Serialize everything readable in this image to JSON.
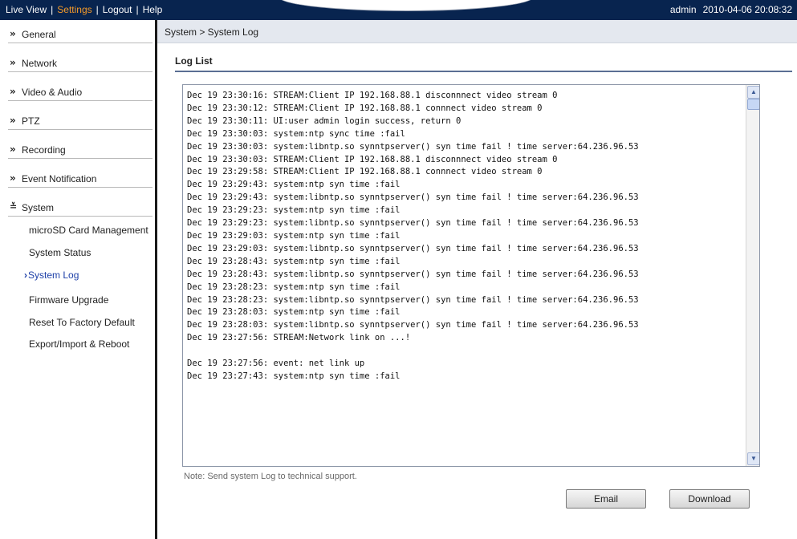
{
  "topbar": {
    "nav": [
      "Live View",
      "Settings",
      "Logout",
      "Help"
    ],
    "active": "Settings",
    "separator": "|",
    "user": "admin",
    "datetime": "2010-04-06 20:08:32"
  },
  "sidebar": {
    "chevron_glyph": "»",
    "open_glyph": "≚",
    "sections": [
      "General",
      "Network",
      "Video & Audio",
      "PTZ",
      "Recording",
      "Event Notification",
      "System"
    ],
    "system_items": [
      "microSD Card Management",
      "System Status",
      "System Log",
      "Firmware Upgrade",
      "Reset To Factory Default",
      "Export/Import & Reboot"
    ],
    "current_item": "System Log",
    "current_marker": "›"
  },
  "main": {
    "breadcrumb": "System > System Log",
    "section_title": "Log List",
    "log_text": "Dec 19 23:30:16: STREAM:Client IP 192.168.88.1 disconnnect video stream 0\nDec 19 23:30:12: STREAM:Client IP 192.168.88.1 connnect video stream 0\nDec 19 23:30:11: UI:user admin login success, return 0\nDec 19 23:30:03: system:ntp sync time :fail\nDec 19 23:30:03: system:libntp.so synntpserver() syn time fail ! time server:64.236.96.53\nDec 19 23:30:03: STREAM:Client IP 192.168.88.1 disconnnect video stream 0\nDec 19 23:29:58: STREAM:Client IP 192.168.88.1 connnect video stream 0\nDec 19 23:29:43: system:ntp syn time :fail\nDec 19 23:29:43: system:libntp.so synntpserver() syn time fail ! time server:64.236.96.53\nDec 19 23:29:23: system:ntp syn time :fail\nDec 19 23:29:23: system:libntp.so synntpserver() syn time fail ! time server:64.236.96.53\nDec 19 23:29:03: system:ntp syn time :fail\nDec 19 23:29:03: system:libntp.so synntpserver() syn time fail ! time server:64.236.96.53\nDec 19 23:28:43: system:ntp syn time :fail\nDec 19 23:28:43: system:libntp.so synntpserver() syn time fail ! time server:64.236.96.53\nDec 19 23:28:23: system:ntp syn time :fail\nDec 19 23:28:23: system:libntp.so synntpserver() syn time fail ! time server:64.236.96.53\nDec 19 23:28:03: system:ntp syn time :fail\nDec 19 23:28:03: system:libntp.so synntpserver() syn time fail ! time server:64.236.96.53\nDec 19 23:27:56: STREAM:Network link on ...!\n\nDec 19 23:27:56: event: net link up\nDec 19 23:27:43: system:ntp syn time :fail",
    "note": "Note: Send system Log to technical support.",
    "email_label": "Email",
    "download_label": "Download"
  },
  "colors": {
    "topbar_bg": "#08244f",
    "active_tab": "#f39a2a",
    "current_item": "#1d3fa8",
    "title_rule": "#5b6f93"
  },
  "icons": [
    "chevron-double-right-icon",
    "chevron-double-down-icon",
    "scroll-up-icon",
    "scroll-down-icon"
  ]
}
